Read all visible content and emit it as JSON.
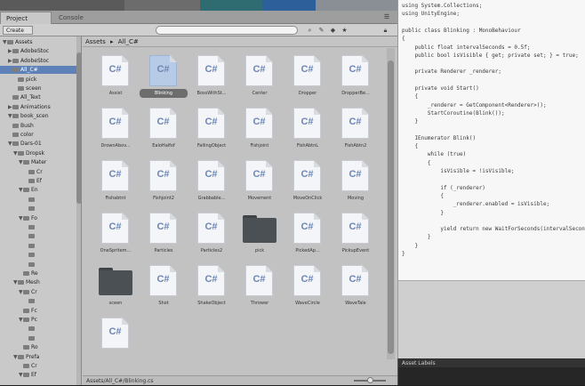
{
  "project_window": {
    "tabs": [
      {
        "label": "Project"
      },
      {
        "label": "Console"
      }
    ],
    "create_label": "Create",
    "breadcrumb": [
      "Assets",
      "▸",
      "All_C#"
    ]
  },
  "tree": [
    {
      "label": "Assets",
      "indent": 0,
      "fold": "▼"
    },
    {
      "label": "AdobeStoc",
      "indent": 1,
      "fold": "▶"
    },
    {
      "label": "AdobeStoc",
      "indent": 1,
      "fold": "▶"
    },
    {
      "label": "All_C#",
      "indent": 1,
      "fold": "",
      "selected": true
    },
    {
      "label": "pick",
      "indent": 2,
      "fold": ""
    },
    {
      "label": "sceen",
      "indent": 2,
      "fold": ""
    },
    {
      "label": "All_Text",
      "indent": 1,
      "fold": ""
    },
    {
      "label": "Animations",
      "indent": 1,
      "fold": "▶"
    },
    {
      "label": "book_scen",
      "indent": 1,
      "fold": "▼"
    },
    {
      "label": "Bush",
      "indent": 1,
      "fold": ""
    },
    {
      "label": "color",
      "indent": 1,
      "fold": ""
    },
    {
      "label": "Dars-01",
      "indent": 1,
      "fold": "▼"
    },
    {
      "label": "Dropsk",
      "indent": 2,
      "fold": "▼"
    },
    {
      "label": "Mater",
      "indent": 3,
      "fold": "▼"
    },
    {
      "label": "Cr",
      "indent": 4,
      "fold": ""
    },
    {
      "label": "Ef",
      "indent": 4,
      "fold": ""
    },
    {
      "label": "En",
      "indent": 3,
      "fold": "▼"
    },
    {
      "label": "",
      "indent": 4,
      "fold": ""
    },
    {
      "label": "",
      "indent": 4,
      "fold": ""
    },
    {
      "label": "Fo",
      "indent": 3,
      "fold": "▼"
    },
    {
      "label": "",
      "indent": 4,
      "fold": ""
    },
    {
      "label": "",
      "indent": 4,
      "fold": ""
    },
    {
      "label": "",
      "indent": 4,
      "fold": ""
    },
    {
      "label": "",
      "indent": 4,
      "fold": ""
    },
    {
      "label": "",
      "indent": 4,
      "fold": ""
    },
    {
      "label": "Re",
      "indent": 3,
      "fold": ""
    },
    {
      "label": "Mesh",
      "indent": 2,
      "fold": "▼"
    },
    {
      "label": "Cr",
      "indent": 3,
      "fold": "▼"
    },
    {
      "label": "",
      "indent": 4,
      "fold": ""
    },
    {
      "label": "Fc",
      "indent": 3,
      "fold": ""
    },
    {
      "label": "Pc",
      "indent": 3,
      "fold": "▼"
    },
    {
      "label": "",
      "indent": 4,
      "fold": ""
    },
    {
      "label": "",
      "indent": 4,
      "fold": ""
    },
    {
      "label": "Ro",
      "indent": 3,
      "fold": ""
    },
    {
      "label": "Prefa",
      "indent": 2,
      "fold": "▼"
    },
    {
      "label": "Cr",
      "indent": 3,
      "fold": ""
    },
    {
      "label": "Ef",
      "indent": 3,
      "fold": "▼"
    }
  ],
  "assets": [
    {
      "name": "Assist",
      "type": "cs"
    },
    {
      "name": "Blinking",
      "type": "cs",
      "selected": true
    },
    {
      "name": "BossWithSt...",
      "type": "cs"
    },
    {
      "name": "Center",
      "type": "cs"
    },
    {
      "name": "Dropper",
      "type": "cs"
    },
    {
      "name": "DropperBe...",
      "type": "cs"
    },
    {
      "name": "DrownAbov...",
      "type": "cs"
    },
    {
      "name": "EaloHalfof",
      "type": "cs"
    },
    {
      "name": "FallingObject",
      "type": "cs"
    },
    {
      "name": "Fishjoint",
      "type": "cs"
    },
    {
      "name": "FishAbtnL",
      "type": "cs"
    },
    {
      "name": "FishAbtn2",
      "type": "cs"
    },
    {
      "name": "Fishabtnt",
      "type": "cs"
    },
    {
      "name": "Fishjoint2",
      "type": "cs"
    },
    {
      "name": "Grabbable...",
      "type": "cs"
    },
    {
      "name": "Movement",
      "type": "cs"
    },
    {
      "name": "MoveOnClick",
      "type": "cs"
    },
    {
      "name": "Moving",
      "type": "cs"
    },
    {
      "name": "OneSpritem...",
      "type": "cs"
    },
    {
      "name": "Particles",
      "type": "cs"
    },
    {
      "name": "Particles2",
      "type": "cs"
    },
    {
      "name": "pick",
      "type": "folder"
    },
    {
      "name": "PickedAp...",
      "type": "cs"
    },
    {
      "name": "PickupEvent",
      "type": "cs"
    },
    {
      "name": "sceen",
      "type": "folder"
    },
    {
      "name": "Shot",
      "type": "cs"
    },
    {
      "name": "ShakeObject",
      "type": "cs"
    },
    {
      "name": "Thrower",
      "type": "cs"
    },
    {
      "name": "WaveCircle",
      "type": "cs"
    },
    {
      "name": "WaveTale",
      "type": "cs"
    },
    {
      "name": "",
      "type": "cs"
    }
  ],
  "status": {
    "path": "Assets/All_C#/Blinking.cs"
  },
  "code": [
    "using System.Collections;",
    "using UnityEngine;",
    "",
    "public class Blinking : MonoBehaviour",
    "{",
    "    public float intervalSeconds = 0.5f;",
    "    public bool isVisible { get; private set; } = true;",
    "",
    "    private Renderer _renderer;",
    "",
    "    private void Start()",
    "    {",
    "        _renderer = GetComponent<Renderer>();",
    "        StartCoroutine(Blink());",
    "    }",
    "",
    "    IEnumerator Blink()",
    "    {",
    "        while (true)",
    "        {",
    "            isVisible = !isVisible;",
    "",
    "            if (_renderer)",
    "            {",
    "                _renderer.enabled = isVisible;",
    "            }",
    "",
    "            yield return new WaitForSeconds(intervalSeconds);",
    "        }",
    "    }",
    "}"
  ],
  "asset_labels": {
    "title": "Asset Labels"
  },
  "icons": {
    "search": "search-icon",
    "lock": "lock-icon",
    "menu": "menu-icon"
  }
}
